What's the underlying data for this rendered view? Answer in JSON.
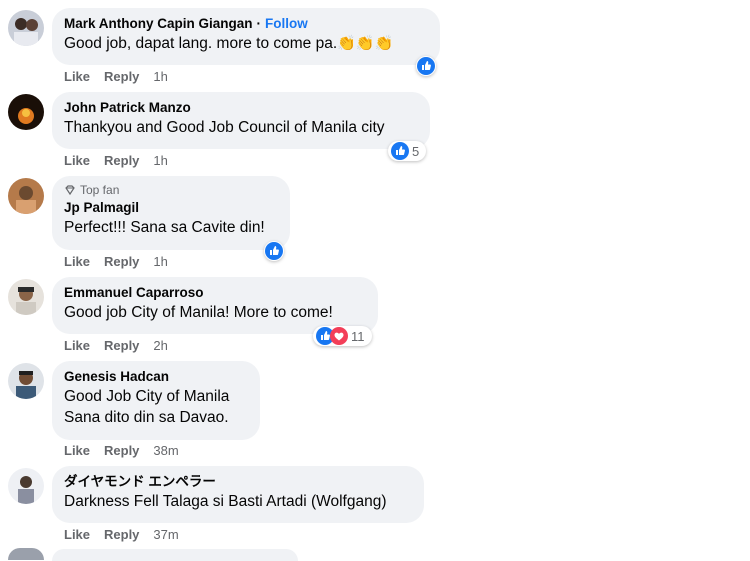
{
  "comments": [
    {
      "author": "Mark Anthony Capin Giangan",
      "follow": "Follow",
      "text": "Good job, dapat lang. more to come pa.",
      "clap": "👏👏👏",
      "like": "Like",
      "reply": "Reply",
      "time": "1h"
    },
    {
      "author": "John Patrick Manzo",
      "text": "Thankyou and Good Job Council of Manila city",
      "like": "Like",
      "reply": "Reply",
      "time": "1h",
      "reaction_count": "5"
    },
    {
      "badge": "Top fan",
      "author": "Jp Palmagil",
      "text": "Perfect!!! Sana sa Cavite din!",
      "like": "Like",
      "reply": "Reply",
      "time": "1h"
    },
    {
      "author": "Emmanuel Caparroso",
      "text": "Good job City of Manila! More to come!",
      "like": "Like",
      "reply": "Reply",
      "time": "2h",
      "reaction_count": "11"
    },
    {
      "author": "Genesis Hadcan",
      "text_lines": [
        "Good Job City of Manila",
        "Sana dito din sa Davao."
      ],
      "like": "Like",
      "reply": "Reply",
      "time": "38m"
    },
    {
      "author": "ダイヤモンド エンペラー",
      "text": "Darkness Fell Talaga si Basti Artadi (Wolfgang)",
      "like": "Like",
      "reply": "Reply",
      "time": "37m"
    }
  ],
  "colors": {
    "bubble": "#f0f2f5",
    "link": "#1877f2",
    "meta": "#65676b",
    "like_blue": "#1877f2",
    "love_red": "#f33e58"
  }
}
